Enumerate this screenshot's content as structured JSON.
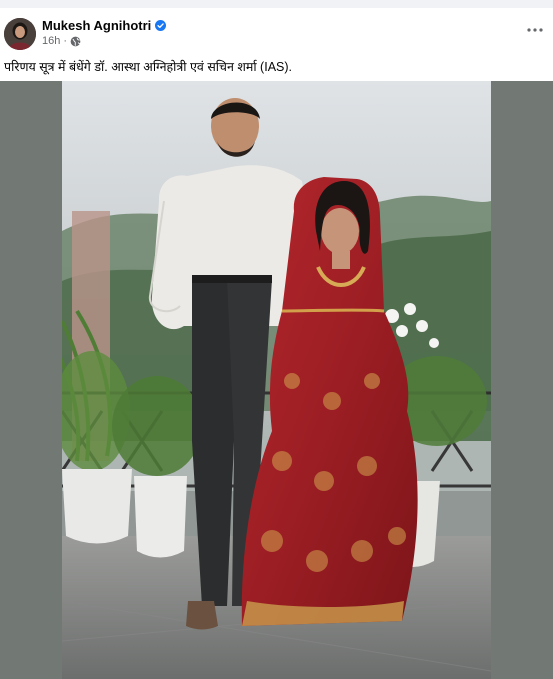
{
  "post": {
    "author": "Mukesh Agnihotri",
    "time": "16h",
    "separator": "·",
    "caption": "परिणय सूत्र में बंधेंगे डॉ. आस्था अग्निहोत्री एवं सचिन शर्मा (IAS)."
  },
  "icons": {
    "verified": "verified-badge-icon",
    "audience": "globe-icon",
    "more": "more-horizontal-icon"
  },
  "colors": {
    "verified": "#1877f2",
    "text_primary": "#050505",
    "text_secondary": "#65676b",
    "media_background": "#727974"
  }
}
